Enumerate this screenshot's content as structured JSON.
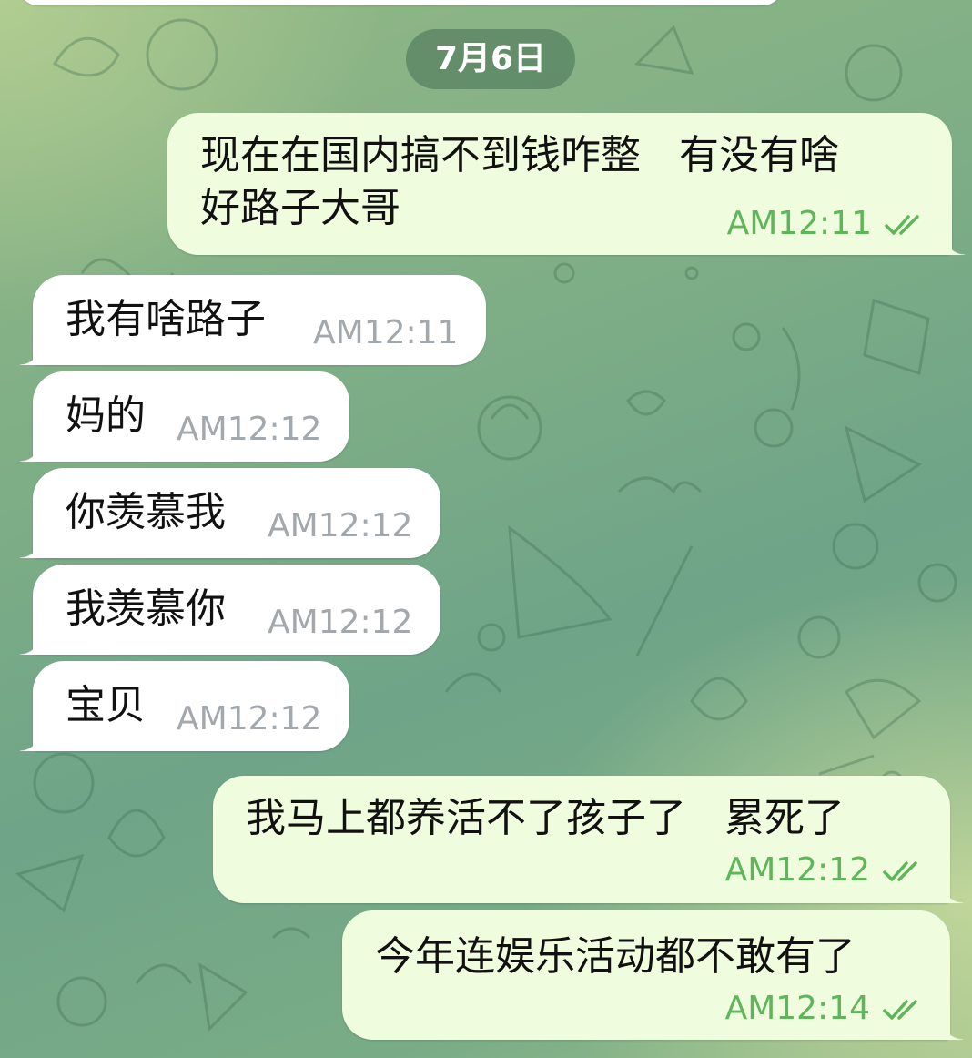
{
  "date_separator": "7月6日",
  "colors": {
    "incoming_bubble": "#ffffff",
    "outgoing_bubble": "#effdde",
    "incoming_time": "#a3a8ad",
    "outgoing_time": "#5fb55a",
    "read_ticks": "#5fb55a"
  },
  "messages": [
    {
      "direction": "outgoing",
      "lines": [
        "现在在国内搞不到钱咋整   有没有啥",
        "好路子大哥"
      ],
      "time": "AM12:11",
      "status_icon": "double-check-icon"
    },
    {
      "direction": "incoming",
      "lines": [
        "我有啥路子"
      ],
      "time": "AM12:11"
    },
    {
      "direction": "incoming",
      "lines": [
        "妈的"
      ],
      "time": "AM12:12"
    },
    {
      "direction": "incoming",
      "lines": [
        "你羡慕我"
      ],
      "time": "AM12:12"
    },
    {
      "direction": "incoming",
      "lines": [
        "我羡慕你"
      ],
      "time": "AM12:12"
    },
    {
      "direction": "incoming",
      "lines": [
        "宝贝"
      ],
      "time": "AM12:12"
    },
    {
      "direction": "outgoing",
      "lines": [
        "我马上都养活不了孩子了   累死了"
      ],
      "time": "AM12:12",
      "status_icon": "double-check-icon"
    },
    {
      "direction": "outgoing",
      "lines": [
        "今年连娱乐活动都不敢有了"
      ],
      "time": "AM12:14",
      "status_icon": "double-check-icon"
    }
  ]
}
